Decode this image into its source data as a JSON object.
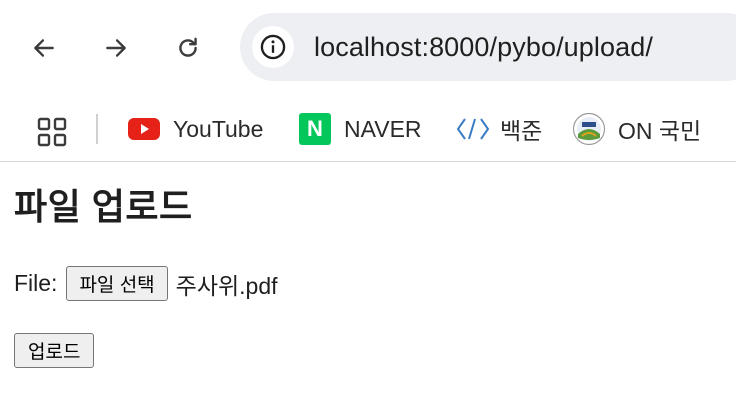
{
  "browser": {
    "url": "localhost:8000/pybo/upload/",
    "bookmarks": [
      {
        "label": "YouTube",
        "icon": "youtube-icon"
      },
      {
        "label": "NAVER",
        "icon": "naver-icon"
      },
      {
        "label": "백준",
        "icon": "code-brackets-icon"
      },
      {
        "label": "ON 국민",
        "icon": "kmu-logo-icon"
      }
    ],
    "naver_glyph": "N"
  },
  "page": {
    "title": "파일 업로드",
    "file_label": "File:",
    "choose_file_button": "파일 선택",
    "selected_file": "주사위.pdf",
    "submit_button": "업로드"
  },
  "colors": {
    "youtube_red": "#e62117",
    "naver_green": "#03c75a",
    "baekjoon_blue": "#3a7cc4",
    "omnibox_bg": "#edeff2"
  }
}
